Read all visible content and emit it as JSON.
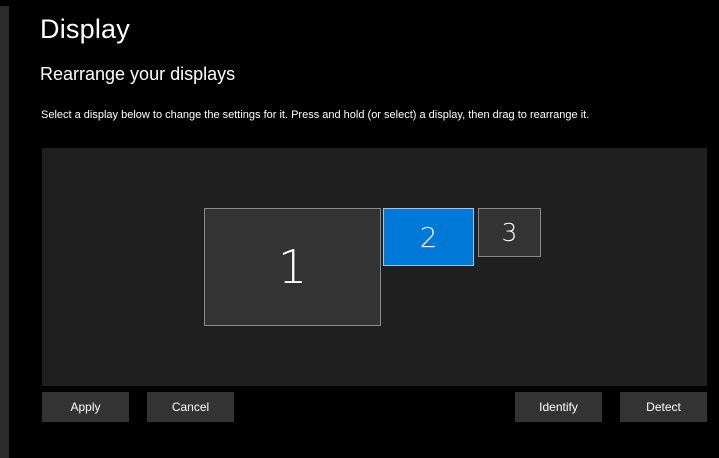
{
  "page": {
    "title": "Display",
    "section_heading": "Rearrange your displays",
    "instruction": "Select a display below to change the settings for it. Press and hold (or select) a display, then drag to rearrange it."
  },
  "arrangement": {
    "displays": [
      {
        "number": "1",
        "selected": false
      },
      {
        "number": "2",
        "selected": true
      },
      {
        "number": "3",
        "selected": false
      }
    ]
  },
  "buttons": {
    "apply": "Apply",
    "cancel": "Cancel",
    "identify": "Identify",
    "detect": "Detect"
  },
  "colors": {
    "background": "#000000",
    "canvas": "#1f1f1f",
    "monitor": "#333333",
    "accent_selected": "#0078d7",
    "button": "#333333",
    "text": "#ffffff"
  }
}
